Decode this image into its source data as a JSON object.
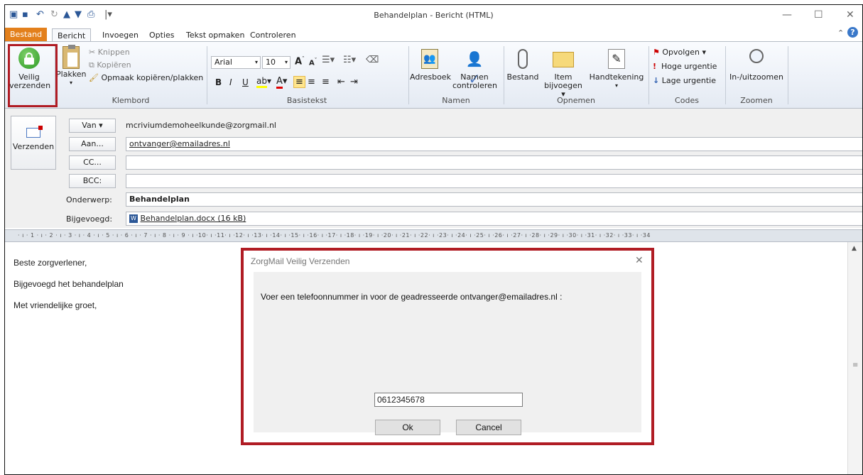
{
  "window": {
    "title": "Behandelplan - Bericht (HTML)"
  },
  "tabs": [
    "Bestand",
    "Bericht",
    "Invoegen",
    "Opties",
    "Tekst opmaken",
    "Controleren"
  ],
  "ribbon": {
    "secure_send": [
      "Veilig",
      "verzenden"
    ],
    "clipboard": {
      "paste": "Plakken",
      "cut": "Knippen",
      "copy": "Kopiëren",
      "format_painter": "Opmaak kopiëren/plakken",
      "label": "Klembord"
    },
    "basic_text": {
      "font": "Arial",
      "size": "10",
      "label": "Basistekst"
    },
    "names": {
      "address_book": "Adresboek",
      "check_names": [
        "Namen",
        "controleren"
      ],
      "label": "Namen"
    },
    "include": {
      "file": "Bestand",
      "item": [
        "Item",
        "bijvoegen ▾"
      ],
      "signature": "Handtekening",
      "label": "Opnemen"
    },
    "tags": {
      "follow_up": "Opvolgen ▾",
      "high": "Hoge urgentie",
      "low": "Lage urgentie",
      "label": "Codes"
    },
    "zoom": {
      "zoom": "In-/uitzoomen",
      "label": "Zoomen"
    }
  },
  "header": {
    "send": "Verzenden",
    "from_btn": "Van ▾",
    "from": "mcriviumdemoheelkunde@zorgmail.nl",
    "to_btn": "Aan...",
    "to": "ontvanger@emailadres.nl",
    "cc_btn": "CC...",
    "bcc_btn": "BCC:",
    "subject_label": "Onderwerp:",
    "subject": "Behandelplan",
    "attached_label": "Bijgevoegd:",
    "attachment": "Behandelplan.docx (16 kB)"
  },
  "ruler": "· ı · 1 · ı · 2 · ı · 3 · ı · 4 · ı · 5 · ı · 6 · ı · 7 · ı · 8 · ı · 9 · ı ·10· ı ·11· ı ·12· ı ·13· ı ·14· ı ·15· ı ·16· ı ·17· ı ·18· ı ·19· ı ·20· ı ·21· ı ·22· ı ·23· ı ·24· ı ·25· ı ·26· ı ·27· ı ·28· ı ·29· ı ·30· ı ·31· ı ·32· ı ·33· ı ·34",
  "body": [
    "Beste zorgverlener,",
    "Bijgevoegd het behandelplan",
    "Met vriendelijke groet,"
  ],
  "dialog": {
    "title": "ZorgMail Veilig Verzenden",
    "prompt": "Voer een telefoonnummer in voor de geadresseerde ontvanger@emailadres.nl :",
    "phone": "0612345678",
    "ok": "Ok",
    "cancel": "Cancel"
  },
  "colors": {
    "highlight": "#b01c24",
    "file_tab": "#e3801c"
  }
}
